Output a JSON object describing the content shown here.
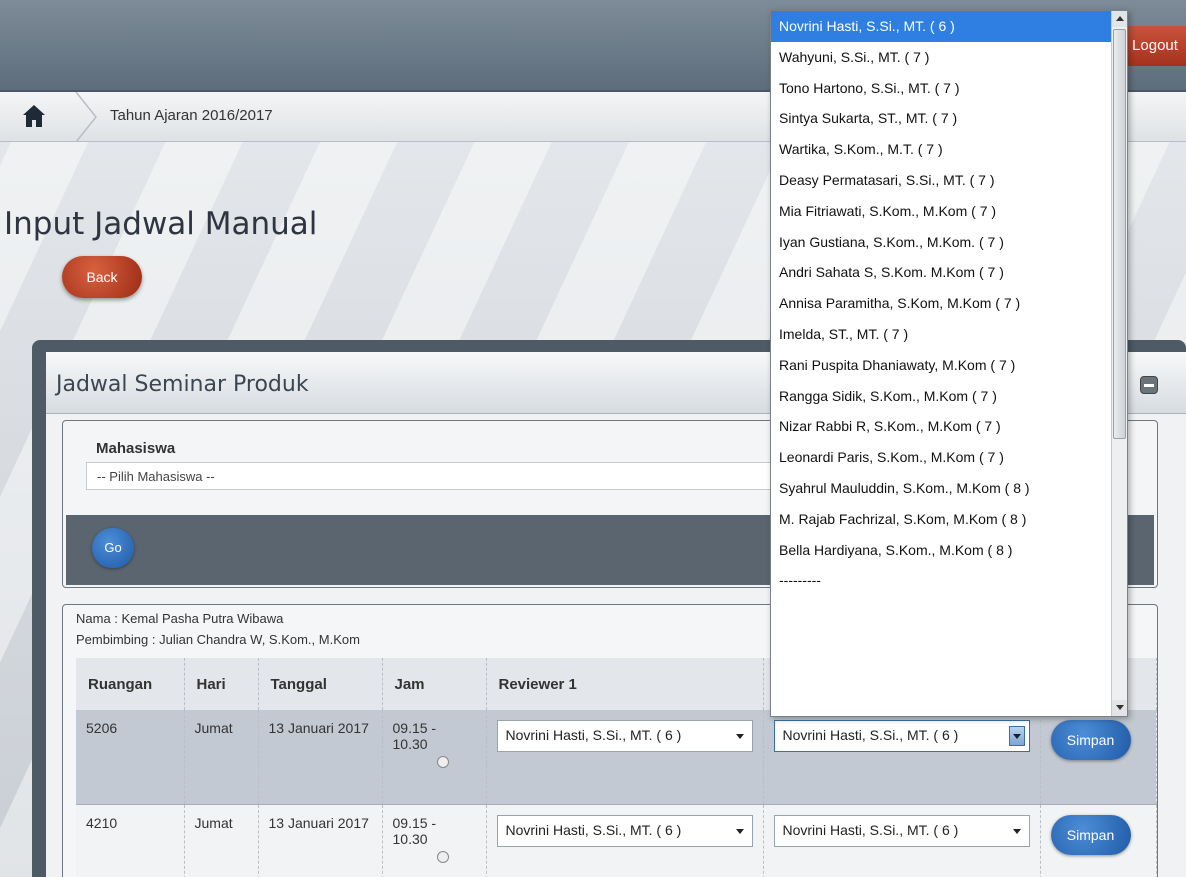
{
  "header": {
    "logout_label": "Logout"
  },
  "breadcrumb": {
    "current": "Tahun Ajaran 2016/2017"
  },
  "page": {
    "title": "Input Jadwal Manual",
    "back_label": "Back"
  },
  "panel": {
    "title": "Jadwal Seminar Produk",
    "filter": {
      "label": "Mahasiswa",
      "select_value": "-- Pilih Mahasiswa --",
      "go_label": "Go"
    },
    "info": {
      "nama": "Nama : Kemal Pasha Putra Wibawa",
      "pembimbing": "Pembimbing : Julian Chandra W, S.Kom., M.Kom"
    },
    "table": {
      "headers": [
        "Ruangan",
        "Hari",
        "Tanggal",
        "Jam",
        "Reviewer 1"
      ],
      "rows": [
        {
          "ruangan": "5206",
          "hari": "Jumat",
          "tanggal": "13 Januari 2017",
          "jam": "09.15 - 10.30",
          "reviewer1": "Novrini Hasti, S.Si., MT. ( 6 )",
          "reviewer2": "Novrini Hasti, S.Si., MT. ( 6 )",
          "save_label": "Simpan"
        },
        {
          "ruangan": "4210",
          "hari": "Jumat",
          "tanggal": "13 Januari 2017",
          "jam": "09.15 - 10.30",
          "reviewer1": "Novrini Hasti, S.Si., MT. ( 6 )",
          "reviewer2": "Novrini Hasti, S.Si., MT. ( 6 )",
          "save_label": "Simpan"
        }
      ]
    }
  },
  "dropdown": {
    "options": [
      "Novrini Hasti, S.Si., MT. ( 6 )",
      "Wahyuni, S.Si., MT. ( 7 )",
      "Tono Hartono, S.Si., MT. ( 7 )",
      "Sintya Sukarta, ST., MT. ( 7 )",
      "Wartika, S.Kom., M.T. ( 7 )",
      "Deasy Permatasari, S.Si., MT. ( 7 )",
      "Mia Fitriawati, S.Kom., M.Kom ( 7 )",
      "Iyan Gustiana, S.Kom., M.Kom. ( 7 )",
      "Andri Sahata S, S.Kom. M.Kom ( 7 )",
      "Annisa Paramitha, S.Kom, M.Kom ( 7 )",
      "Imelda, ST., MT. ( 7 )",
      "Rani Puspita Dhaniawaty, M.Kom ( 7 )",
      "Rangga Sidik, S.Kom., M.Kom ( 7 )",
      "Nizar Rabbi R, S.Kom., M.Kom ( 7 )",
      "Leonardi Paris, S.Kom., M.Kom ( 7 )",
      "Syahrul Mauluddin, S.Kom., M.Kom ( 8 )",
      "M. Rajab Fachrizal, S.Kom, M.Kom ( 8 )",
      "Bella Hardiyana, S.Kom., M.Kom ( 8 )",
      "---------"
    ],
    "selected_index": 0
  },
  "colors": {
    "accent_blue": "#1f5aa6",
    "accent_red": "#a4321e",
    "selected_option": "#2f7fe3"
  }
}
